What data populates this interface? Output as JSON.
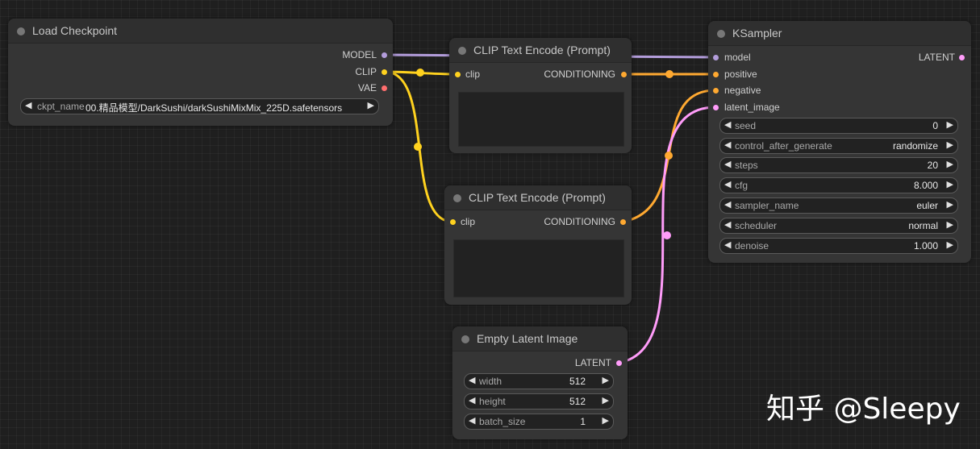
{
  "colors": {
    "model": "#b39ddb",
    "clip": "#ffd21f",
    "vae": "#ff6e6e",
    "conditioning": "#ffa931",
    "latent": "#ff9cf9"
  },
  "load_checkpoint": {
    "title": "Load Checkpoint",
    "outputs": [
      "MODEL",
      "CLIP",
      "VAE"
    ],
    "ckpt_name_label": "ckpt_name",
    "ckpt_name_value": "00.精品模型/DarkSushi/darkSushiMixMix_225D.safetensors"
  },
  "clip_encode_1": {
    "title": "CLIP Text Encode (Prompt)",
    "input": "clip",
    "output": "CONDITIONING"
  },
  "clip_encode_2": {
    "title": "CLIP Text Encode (Prompt)",
    "input": "clip",
    "output": "CONDITIONING"
  },
  "ksampler": {
    "title": "KSampler",
    "inputs": [
      "model",
      "positive",
      "negative",
      "latent_image"
    ],
    "output": "LATENT",
    "widgets": [
      {
        "name": "seed",
        "value": "0"
      },
      {
        "name": "control_after_generate",
        "value": "randomize"
      },
      {
        "name": "steps",
        "value": "20"
      },
      {
        "name": "cfg",
        "value": "8.000"
      },
      {
        "name": "sampler_name",
        "value": "euler"
      },
      {
        "name": "scheduler",
        "value": "normal"
      },
      {
        "name": "denoise",
        "value": "1.000"
      }
    ]
  },
  "empty_latent": {
    "title": "Empty Latent Image",
    "output": "LATENT",
    "widgets": [
      {
        "name": "width",
        "value": "512"
      },
      {
        "name": "height",
        "value": "512"
      },
      {
        "name": "batch_size",
        "value": "1"
      }
    ]
  },
  "watermark": "知乎 @Sleepy"
}
